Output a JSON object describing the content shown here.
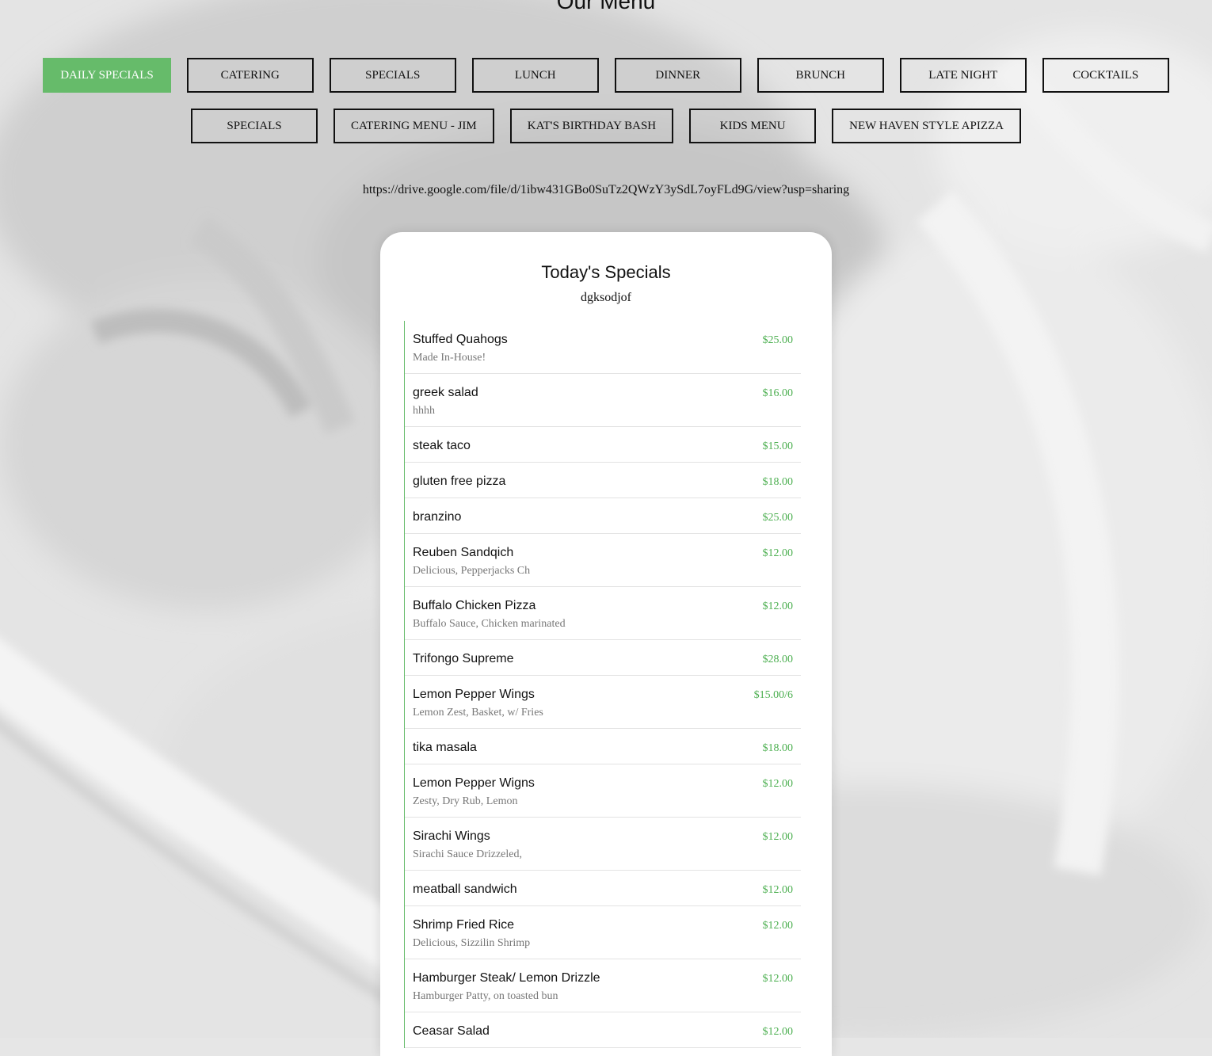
{
  "page": {
    "title": "Our Menu",
    "link": "https://drive.google.com/file/d/1ibw431GBo0SuTz2QWzY3ySdL7oyFLd9G/view?usp=sharing"
  },
  "colors": {
    "accent": "#66bb6a",
    "price": "#4caf50"
  },
  "tabs_row1": [
    {
      "label": "DAILY SPECIALS",
      "active": true
    },
    {
      "label": "CATERING",
      "active": false
    },
    {
      "label": "SPECIALS",
      "active": false
    },
    {
      "label": "LUNCH",
      "active": false
    },
    {
      "label": "DINNER",
      "active": false
    },
    {
      "label": "BRUNCH",
      "active": false
    },
    {
      "label": "LATE NIGHT",
      "active": false
    },
    {
      "label": "COCKTAILS",
      "active": false
    }
  ],
  "tabs_row2": [
    {
      "label": "SPECIALS",
      "active": false
    },
    {
      "label": "CATERING MENU - JIM",
      "active": false
    },
    {
      "label": "KAT'S BIRTHDAY BASH",
      "active": false
    },
    {
      "label": "KIDS MENU",
      "active": false
    },
    {
      "label": "NEW HAVEN STYLE APIZZA",
      "active": false
    }
  ],
  "specials": {
    "title": "Today's Specials",
    "subtitle": "dgksodjof",
    "items": [
      {
        "name": "Stuffed Quahogs",
        "price": "$25.00",
        "desc": "Made In-House!"
      },
      {
        "name": "greek salad",
        "price": "$16.00",
        "desc": "hhhh"
      },
      {
        "name": "steak taco",
        "price": "$15.00",
        "desc": ""
      },
      {
        "name": "gluten free pizza",
        "price": "$18.00",
        "desc": ""
      },
      {
        "name": "branzino",
        "price": "$25.00",
        "desc": ""
      },
      {
        "name": "Reuben Sandqich",
        "price": "$12.00",
        "desc": "Delicious, Pepperjacks Ch"
      },
      {
        "name": "Buffalo Chicken Pizza",
        "price": "$12.00",
        "desc": "Buffalo Sauce, Chicken marinated"
      },
      {
        "name": "Trifongo Supreme",
        "price": "$28.00",
        "desc": ""
      },
      {
        "name": "Lemon Pepper Wings",
        "price": "$15.00/6",
        "desc": "Lemon Zest, Basket, w/ Fries"
      },
      {
        "name": "tika masala",
        "price": "$18.00",
        "desc": ""
      },
      {
        "name": "Lemon Pepper Wigns",
        "price": "$12.00",
        "desc": "Zesty, Dry Rub, Lemon"
      },
      {
        "name": "Sirachi Wings",
        "price": "$12.00",
        "desc": "Sirachi Sauce Drizzeled,"
      },
      {
        "name": "meatball sandwich",
        "price": "$12.00",
        "desc": ""
      },
      {
        "name": "Shrimp Fried Rice",
        "price": "$12.00",
        "desc": "Delicious, Sizzilin Shrimp"
      },
      {
        "name": "Hamburger Steak/ Lemon Drizzle",
        "price": "$12.00",
        "desc": "Hamburger Patty, on toasted bun"
      },
      {
        "name": "Ceasar Salad",
        "price": "$12.00",
        "desc": ""
      }
    ]
  }
}
